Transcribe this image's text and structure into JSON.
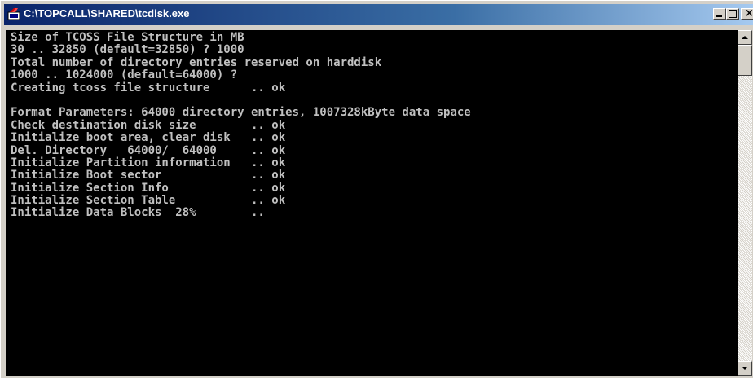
{
  "window": {
    "title": "C:\\TOPCALL\\SHARED\\tcdisk.exe",
    "close_glyph": "×"
  },
  "icons": {
    "title_icon": "console-app-icon",
    "minimize": "minimize-icon",
    "maximize": "maximize-icon",
    "close": "close-icon",
    "scroll_up": "arrow-up-icon",
    "scroll_down": "arrow-down-icon"
  },
  "colors": {
    "console_background": "#000000",
    "console_text": "#c0c0c0",
    "titlebar_start": "#0a246a",
    "titlebar_end": "#a6caf0"
  },
  "console": {
    "lines": [
      "Size of TCOSS File Structure in MB",
      "30 .. 32850 (default=32850) ? 1000",
      "Total number of directory entries reserved on harddisk",
      "1000 .. 1024000 (default=64000) ?",
      "Creating tcoss file structure      .. ok",
      "",
      "Format Parameters: 64000 directory entries, 1007328kByte data space",
      "Check destination disk size        .. ok",
      "Initialize boot area, clear disk   .. ok",
      "Del. Directory   64000/  64000     .. ok",
      "Initialize Partition information   .. ok",
      "Initialize Boot sector             .. ok",
      "Initialize Section Info            .. ok",
      "Initialize Section Table           .. ok",
      "Initialize Data Blocks  28%        .."
    ]
  },
  "scrollbar": {
    "position_fraction": 0.0
  }
}
